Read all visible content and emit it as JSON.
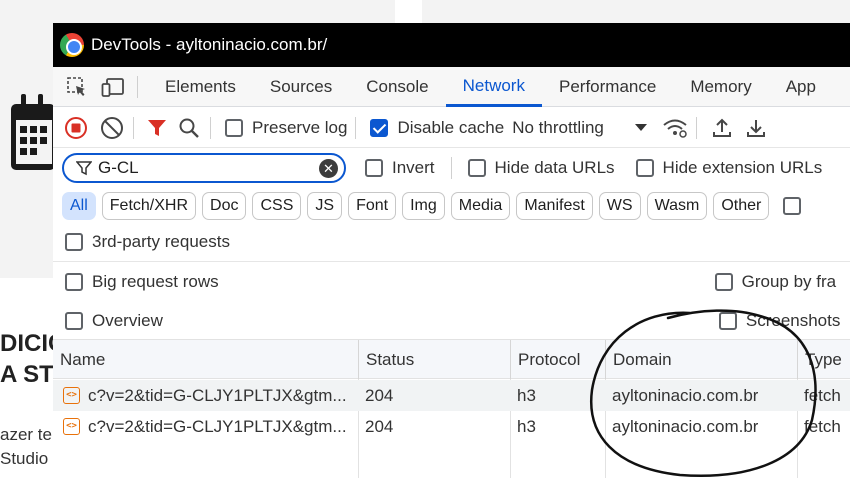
{
  "background": {
    "heading_lines": [
      "DICIC",
      "A STU"
    ],
    "text_lines": [
      "azer te",
      "Studio"
    ]
  },
  "window": {
    "title": "DevTools - ayltoninacio.com.br/"
  },
  "tabs": [
    "Elements",
    "Sources",
    "Console",
    "Network",
    "Performance",
    "Memory",
    "App"
  ],
  "active_tab": "Network",
  "toolbar": {
    "preserve_log": "Preserve log",
    "preserve_log_checked": false,
    "disable_cache": "Disable cache",
    "disable_cache_checked": true,
    "throttling": "No throttling"
  },
  "filter": {
    "value": "G-CL",
    "invert": "Invert",
    "hide_data_urls": "Hide data URLs",
    "hide_extension_urls": "Hide extension URLs"
  },
  "type_filters": [
    "All",
    "Fetch/XHR",
    "Doc",
    "CSS",
    "JS",
    "Font",
    "Img",
    "Media",
    "Manifest",
    "WS",
    "Wasm",
    "Other"
  ],
  "active_type_filter": "All",
  "options": {
    "third_party": "3rd-party requests",
    "big_rows": "Big request rows",
    "group_by_frame": "Group by fra",
    "overview": "Overview",
    "screenshots": "Screenshots"
  },
  "table": {
    "columns": [
      "Name",
      "Status",
      "Protocol",
      "Domain",
      "Type"
    ],
    "rows": [
      {
        "name": "c?v=2&tid=G-CLJY1PLTJX&gtm...",
        "status": "204",
        "protocol": "h3",
        "domain": "ayltoninacio.com.br",
        "type": "fetch"
      },
      {
        "name": "c?v=2&tid=G-CLJY1PLTJX&gtm...",
        "status": "204",
        "protocol": "h3",
        "domain": "ayltoninacio.com.br",
        "type": "fetch"
      }
    ]
  },
  "colors": {
    "accent": "#0b57d0",
    "record_red": "#d93025",
    "annotation": "#111111"
  }
}
